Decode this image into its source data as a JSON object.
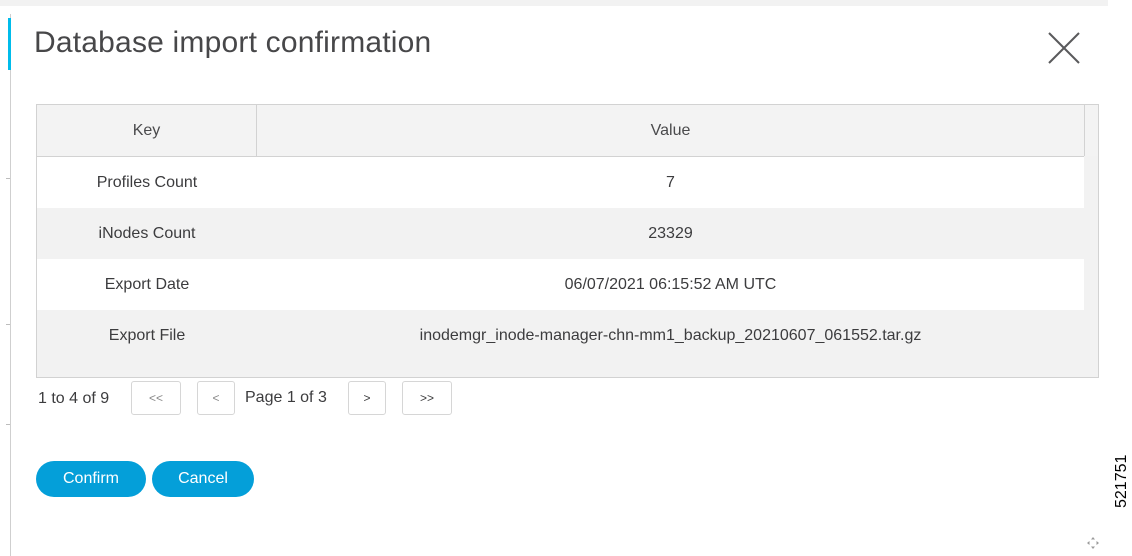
{
  "dialog": {
    "title": "Database import confirmation",
    "close_icon": "close-icon"
  },
  "table": {
    "headers": {
      "key": "Key",
      "value": "Value"
    },
    "rows": [
      {
        "key": "Profiles Count",
        "value": "7"
      },
      {
        "key": "iNodes Count",
        "value": "23329"
      },
      {
        "key": "Export Date",
        "value": "06/07/2021 06:15:52 AM UTC"
      },
      {
        "key": "Export File",
        "value": "inodemgr_inode-manager-chn-mm1_backup_20210607_061552.tar.gz"
      }
    ]
  },
  "pagination": {
    "range": "1 to 4 of 9",
    "first": "<<",
    "prev": "<",
    "page_label": "Page 1 of 3",
    "next": ">",
    "last": ">>"
  },
  "actions": {
    "confirm": "Confirm",
    "cancel": "Cancel"
  },
  "figure_id": "521751",
  "colors": {
    "primary_button": "#049fd9",
    "accent": "#00bceb",
    "row_alt": "#f2f2f2",
    "border": "#d2d2d2"
  }
}
